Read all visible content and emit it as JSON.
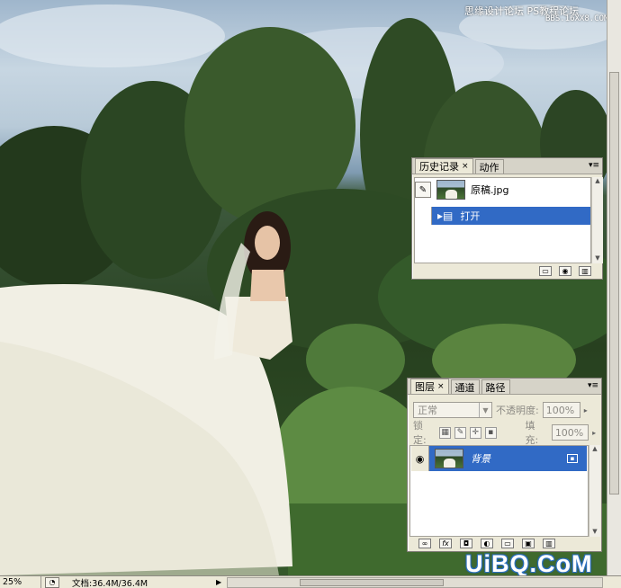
{
  "watermark": {
    "top_line1": "思缘设计论坛  PS教程论坛",
    "top_line2": "BBS.16XX8.COM",
    "bottom": "UiBQ.CoM"
  },
  "history_panel": {
    "tabs": [
      {
        "label": "历史记录",
        "close": "×",
        "active": true
      },
      {
        "label": "动作",
        "close": "",
        "active": false
      }
    ],
    "menu_icon": "▾≡",
    "snapshot_name": "原稿.jpg",
    "steps": [
      {
        "label": "打开",
        "selected": true
      }
    ],
    "footer_icons": [
      "new-document-icon",
      "camera-icon",
      "trash-icon"
    ]
  },
  "layers_panel": {
    "tabs": [
      {
        "label": "图层",
        "close": "×",
        "active": true
      },
      {
        "label": "通道",
        "close": "",
        "active": false
      },
      {
        "label": "路径",
        "close": "",
        "active": false
      }
    ],
    "menu_icon": "▾≡",
    "blend_mode": "正常",
    "opacity_label": "不透明度:",
    "opacity_value": "100%",
    "lock_label": "锁定:",
    "fill_label": "填充:",
    "fill_value": "100%",
    "layers": [
      {
        "name": "背景",
        "visible": true,
        "locked": true
      }
    ],
    "footer_icons": [
      "link-icon",
      "fx-icon",
      "mask-icon",
      "adjustment-icon",
      "folder-icon",
      "new-layer-icon",
      "trash-icon"
    ]
  },
  "status_bar": {
    "zoom": "25%",
    "doc_info": "文档:36.4M/36.4M"
  }
}
